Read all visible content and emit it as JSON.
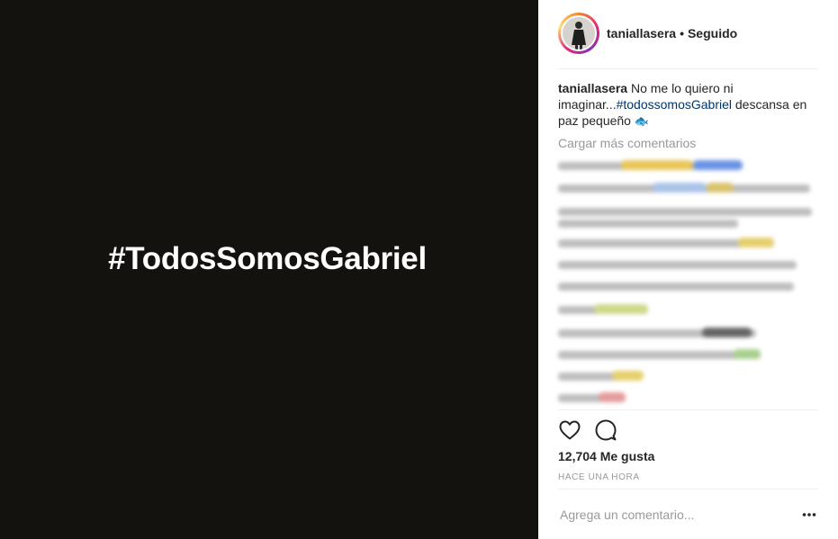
{
  "media": {
    "overlay_text": "#TodosSomosGabriel",
    "background": "#14120f"
  },
  "header": {
    "username": "taniallasera",
    "separator": "•",
    "follow_status": "Seguido"
  },
  "caption": {
    "username": "taniallasera",
    "text_before": " No me lo quiero ni imaginar...",
    "hashtag": "#todossomosGabriel",
    "text_after": " descansa en paz pequeño ",
    "emoji": "🐟"
  },
  "comments": {
    "load_more": "Cargar más comentarios"
  },
  "actions": {
    "like_icon": "heart-icon",
    "comment_icon": "comment-icon"
  },
  "likes": {
    "text": "12,704 Me gusta"
  },
  "timestamp": "HACE UNA HORA",
  "comment_box": {
    "placeholder": "Agrega un comentario...",
    "more_icon": "more-options-icon"
  },
  "colors": {
    "hashtag": "#003569",
    "muted": "#999999",
    "text": "#262626",
    "divider": "#efefef"
  }
}
